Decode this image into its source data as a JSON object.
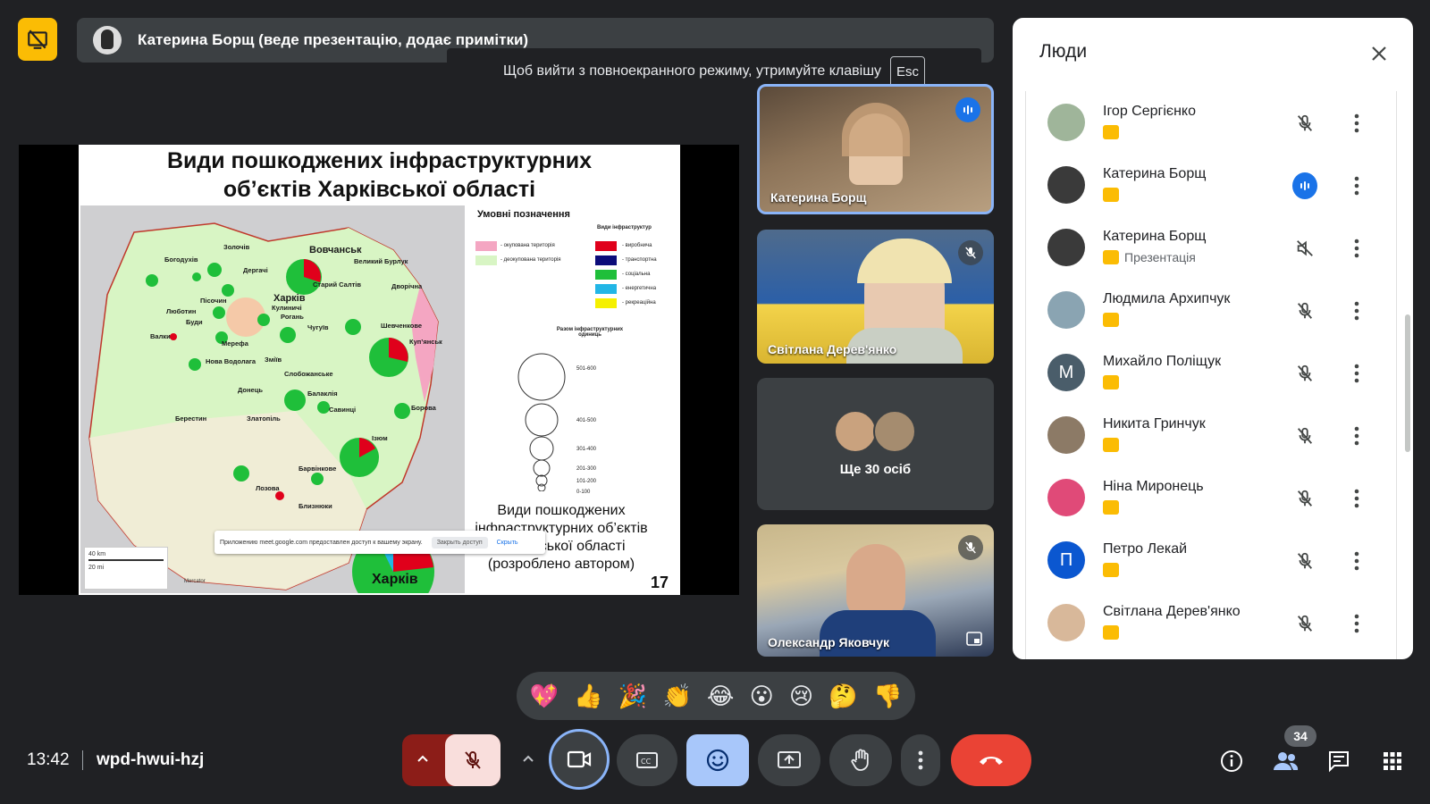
{
  "presenter": {
    "label": "Катерина Борщ (веде презентацію, додає примітки)"
  },
  "fullscreen_toast": {
    "message": "Щоб вийти з повноекранного режиму, утримуйте клавішу",
    "key": "Esc"
  },
  "slide": {
    "title_line1": "Види пошкоджених інфраструктурних",
    "title_line2": "об’єктів Харківської області",
    "legend_title": "Умовні позначення",
    "legend_infra_title": "Види інфраструктур",
    "legend_items": [
      "- окупована територія",
      "- деокупована територія"
    ],
    "legend_infra_items": [
      "- виробнича",
      "- транспортна",
      "- соціальна",
      "- енергетична",
      "- рекреаційна"
    ],
    "size_title": "Разом інфраструктурних одиниць",
    "size_ranges": [
      "501-600",
      "401-500",
      "301-400",
      "201-300",
      "101-200",
      "0-100"
    ],
    "caption": "Види пошкоджених інфраструктурних об’єктів Харківської області (розроблено автором)",
    "page_number": "17",
    "city_label": "Харків",
    "places": [
      "Вовчанськ",
      "Золочів",
      "Богодухів",
      "Дергачі",
      "Великий Бурлук",
      "Старий Салтів",
      "Дворічна",
      "Харків",
      "Кулиничі",
      "Рогань",
      "Чугуїв",
      "Шевченкове",
      "Куп’янськ",
      "Пісочин",
      "Люботин",
      "Буди",
      "Валки",
      "Мерефа",
      "Нова Водолага",
      "Зміїв",
      "Слобожанське",
      "Балаклія",
      "Донець",
      "Савинці",
      "Борова",
      "Берестин",
      "Златопіль",
      "Ізюм",
      "Барвінкове",
      "Лозова",
      "Близнюки"
    ],
    "scale": [
      "40 km",
      "20 mi"
    ],
    "projection": "Mercator",
    "share_note": {
      "text": "Приложению meet.google.com предоставлен доступ к вашему экрану.",
      "button": "Закрыть доступ",
      "link": "Скрыть"
    },
    "colors": {
      "occupied": "#f4a6c2",
      "deoccupied": "#d8f5c4",
      "production": "#e0001b",
      "transport": "#0c0c7a",
      "social": "#1fbf3a",
      "energy": "#22b6e6",
      "recreation": "#f5f000"
    }
  },
  "tiles": [
    {
      "name": "Катерина Борщ",
      "state": "speaking"
    },
    {
      "name": "Світлана Дерев'янко",
      "state": "muted"
    },
    {
      "more_label": "Ще 30 осіб"
    },
    {
      "name": "Олександр Яковчук",
      "state": "muted"
    }
  ],
  "people_panel": {
    "title": "Люди",
    "people": [
      {
        "name": "Ігор Сергієнко",
        "sub": "",
        "mic": "muted",
        "avatar_bg": "#9fb59a"
      },
      {
        "name": "Катерина Борщ",
        "sub": "",
        "mic": "speaking",
        "avatar_bg": "#3a3a3a"
      },
      {
        "name": "Катерина Борщ",
        "sub": "Презентація",
        "mic": "muted-volume",
        "avatar_bg": "#3a3a3a"
      },
      {
        "name": "Людмила Архипчук",
        "sub": "",
        "mic": "muted",
        "avatar_bg": "#8aa4b2"
      },
      {
        "name": "Михайло Поліщук",
        "sub": "",
        "mic": "muted",
        "avatar_bg": "#4a5d6a",
        "initial": "М"
      },
      {
        "name": "Никита Гринчук",
        "sub": "",
        "mic": "muted",
        "avatar_bg": "#8c7a66"
      },
      {
        "name": "Ніна Миронець",
        "sub": "",
        "mic": "muted",
        "avatar_bg": "#e04a78"
      },
      {
        "name": "Петро Лекай",
        "sub": "",
        "mic": "muted",
        "avatar_bg": "#0b57d0",
        "initial": "П"
      },
      {
        "name": "Світлана Дерев'янко",
        "sub": "",
        "mic": "muted",
        "avatar_bg": "#d8b89a"
      }
    ]
  },
  "reactions": [
    "💖",
    "👍",
    "🎉",
    "👏",
    "😂",
    "😮",
    "😢",
    "🤔",
    "👎"
  ],
  "bottom_bar": {
    "time": "13:42",
    "meeting_code": "wpd-hwui-hzj",
    "participant_count": "34"
  }
}
